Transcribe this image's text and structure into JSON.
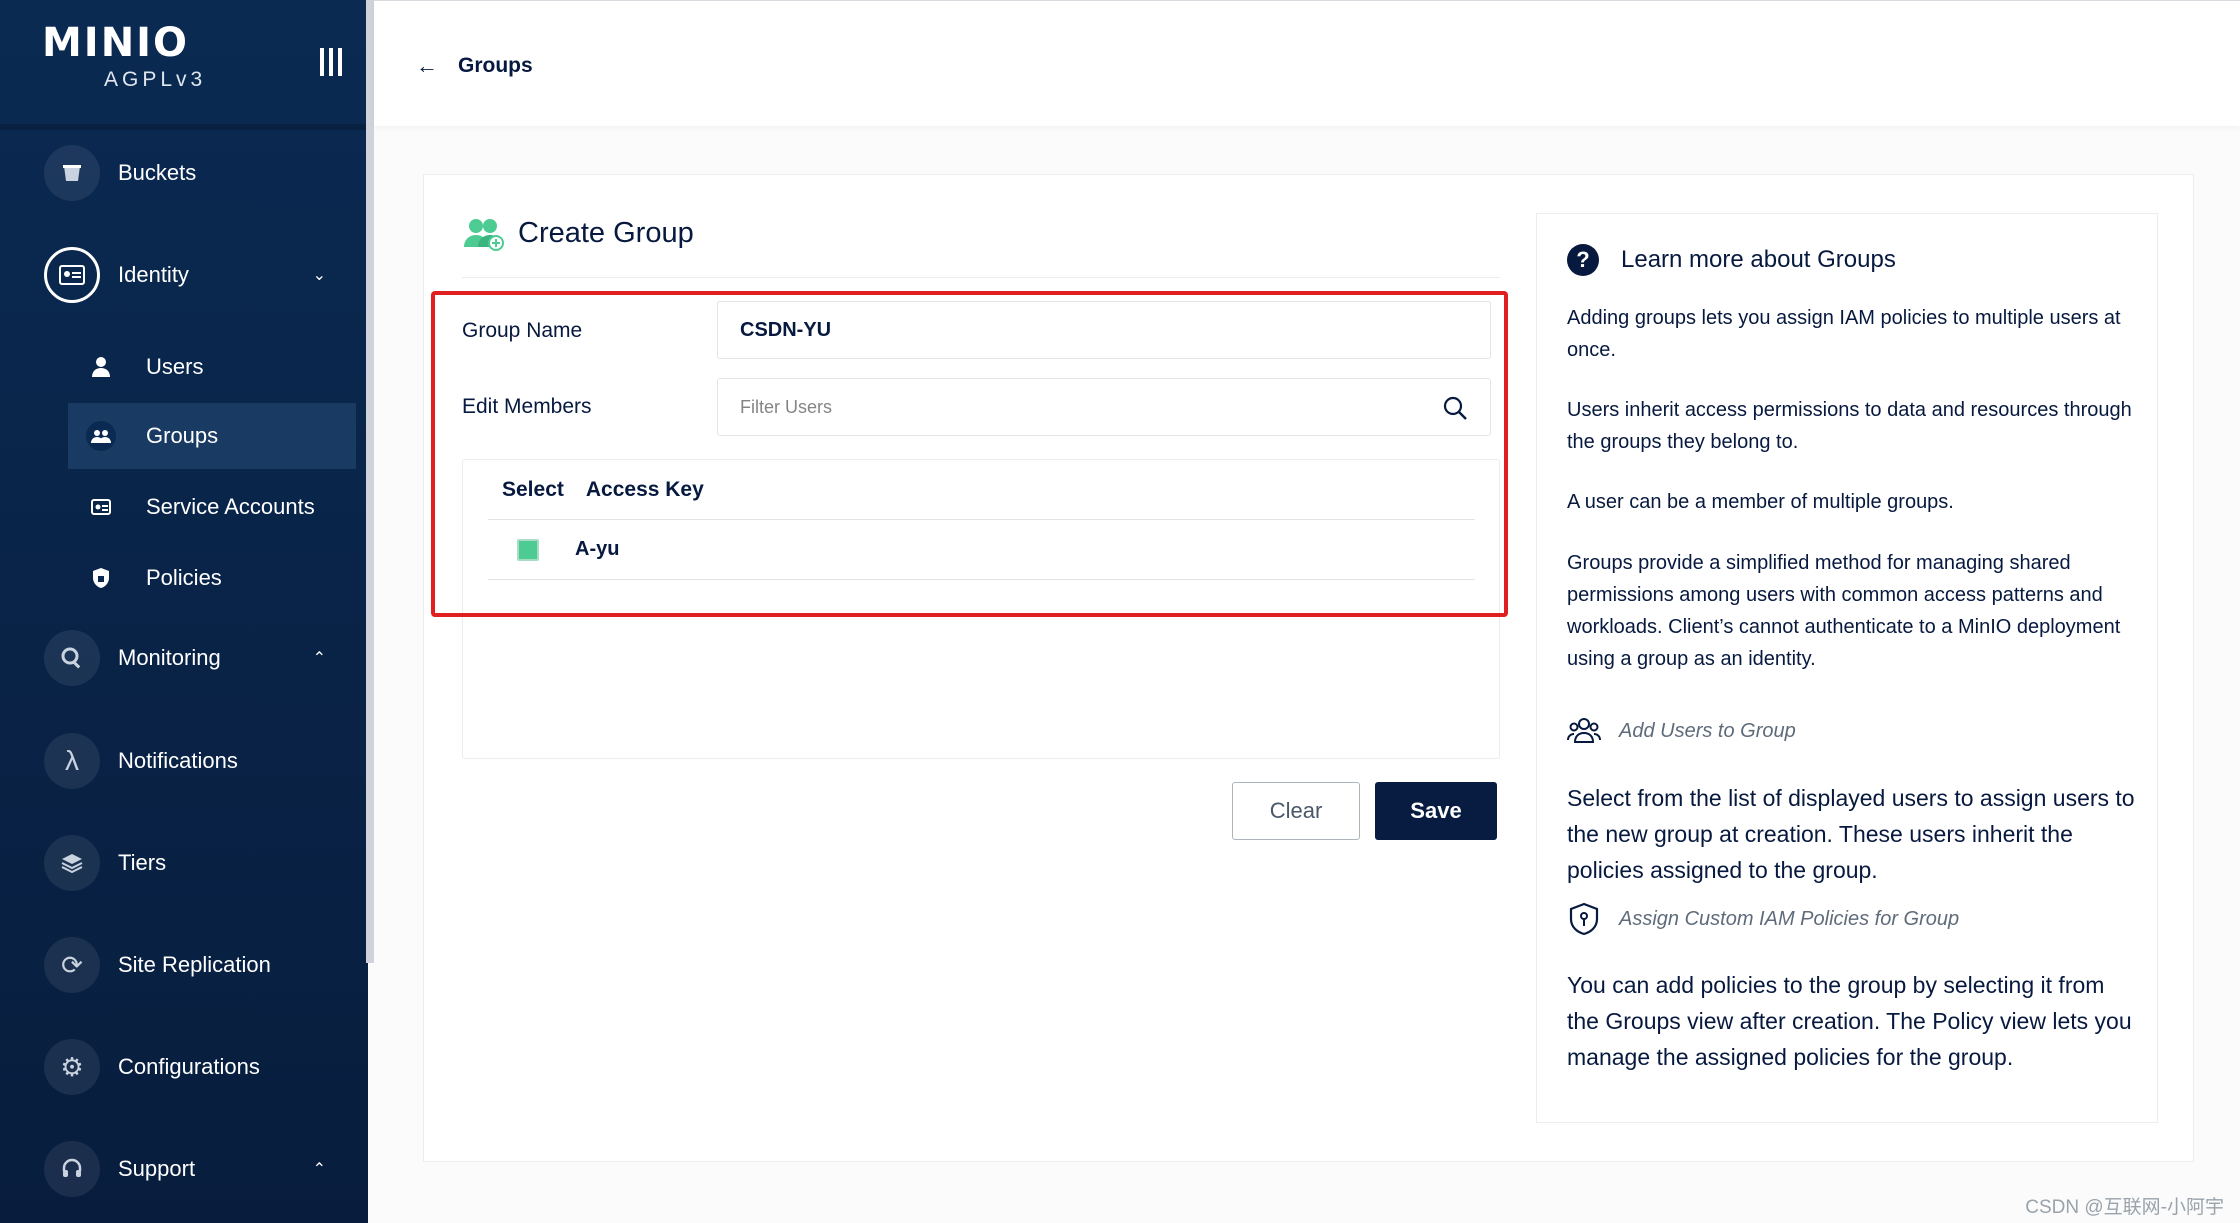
{
  "brand": {
    "logo": "MINIO",
    "license": "AGPLv3"
  },
  "sidebar": {
    "items": [
      {
        "label": "Buckets",
        "icon": "bucket-icon"
      },
      {
        "label": "Identity",
        "icon": "id-card-icon"
      },
      {
        "label": "Monitoring",
        "icon": "magnifier-chart-icon"
      },
      {
        "label": "Notifications",
        "icon": "lambda-icon"
      },
      {
        "label": "Tiers",
        "icon": "layers-icon"
      },
      {
        "label": "Site Replication",
        "icon": "sync-icon"
      },
      {
        "label": "Configurations",
        "icon": "gear-icon"
      },
      {
        "label": "Support",
        "icon": "headset-icon"
      }
    ],
    "identity_sub": [
      {
        "label": "Users",
        "icon": "user-icon"
      },
      {
        "label": "Groups",
        "icon": "group-icon"
      },
      {
        "label": "Service Accounts",
        "icon": "service-account-icon"
      },
      {
        "label": "Policies",
        "icon": "policy-shield-icon"
      }
    ]
  },
  "topbar": {
    "back_label": "Groups"
  },
  "form": {
    "title": "Create Group",
    "group_name_label": "Group Name",
    "group_name_value": "CSDN-YU",
    "edit_members_label": "Edit Members",
    "filter_placeholder": "Filter Users",
    "table": {
      "columns": [
        "Select",
        "Access Key"
      ],
      "rows": [
        {
          "selected": true,
          "access_key": "A-yu"
        }
      ]
    },
    "clear_label": "Clear",
    "save_label": "Save"
  },
  "help": {
    "heading": "Learn more about Groups",
    "p1": "Adding groups lets you assign IAM policies to multiple users at once.",
    "p2": "Users inherit access permissions to data and resources through the groups they belong to.",
    "p3": "A user can be a member of multiple groups.",
    "p4": "Groups provide a simplified method for managing shared permissions among users with common access patterns and workloads. Client’s cannot authenticate to a MinIO deployment using a group as an identity.",
    "sub1": "Add Users to Group",
    "p5": "Select from the list of displayed users to assign users to the new group at creation. These users inherit the policies assigned to the group.",
    "sub2": "Assign Custom IAM Policies for Group",
    "p6": "You can add policies to the group by selecting it from the Groups view after creation. The Policy view lets you manage the assigned policies for the group."
  },
  "watermark": "CSDN @互联网-小阿宇",
  "colors": {
    "sidebar_bg": "#0a2a52",
    "primary": "#081c42",
    "accent_green": "#4ccb92",
    "highlight_red": "#e02020"
  }
}
